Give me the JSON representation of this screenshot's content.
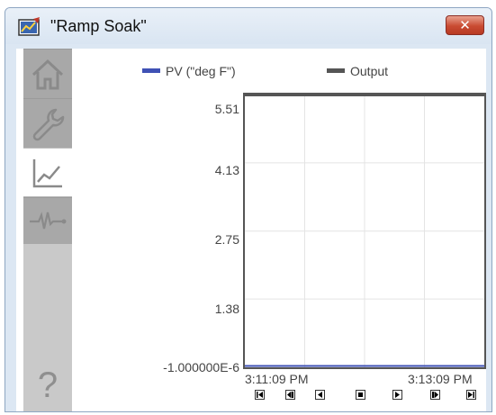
{
  "window": {
    "title": "\"Ramp Soak\"",
    "close_glyph": "✕"
  },
  "sidebar": {
    "items": [
      {
        "name": "home",
        "icon": "home-icon",
        "selected": false
      },
      {
        "name": "maintenance",
        "icon": "wrench-icon",
        "selected": false
      },
      {
        "name": "trend",
        "icon": "trend-chart-icon",
        "selected": true
      },
      {
        "name": "signal",
        "icon": "waveform-icon",
        "selected": false
      }
    ],
    "help_label": "?"
  },
  "chart_data": {
    "type": "line",
    "series": [
      {
        "name": "PV (\"deg F\")",
        "color": "#3f51b5",
        "values": [
          0,
          0
        ]
      },
      {
        "name": "Output",
        "color": "#555555",
        "values": [
          5.51,
          5.51
        ]
      }
    ],
    "x": [
      "3:11:09 PM",
      "3:13:09 PM"
    ],
    "y_ticks": [
      "5.51",
      "4.13",
      "2.75",
      "1.38",
      "-1.000000E-6"
    ],
    "ylim": [
      -1e-06,
      5.51
    ],
    "grid": true,
    "legend": "top"
  },
  "scroll_buttons": [
    {
      "name": "first",
      "icon": "skip-first-icon"
    },
    {
      "name": "page-back",
      "icon": "page-back-icon"
    },
    {
      "name": "step-back",
      "icon": "step-back-icon"
    },
    {
      "name": "stop",
      "icon": "stop-icon"
    },
    {
      "name": "step-forward",
      "icon": "step-forward-icon"
    },
    {
      "name": "page-forward",
      "icon": "page-forward-icon"
    },
    {
      "name": "last",
      "icon": "skip-last-icon"
    }
  ]
}
